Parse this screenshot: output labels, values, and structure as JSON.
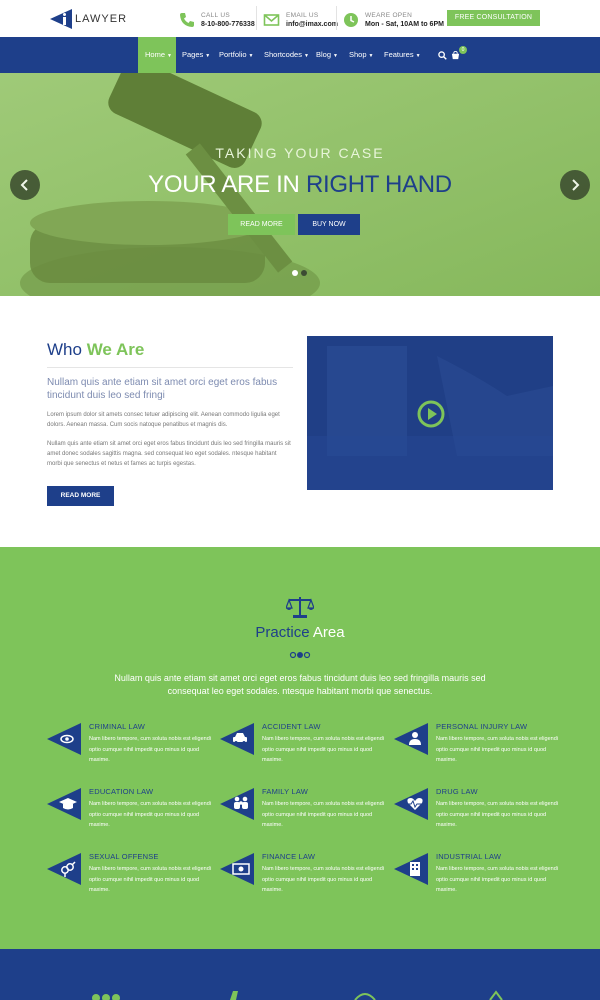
{
  "brand": {
    "logo_text": "LAWYER"
  },
  "contact": {
    "call_label": "CALL US",
    "call_value": "8-10-800-776338",
    "email_label": "EMAIL US",
    "email_value": "info@imax.com",
    "open_label": "WEARE OPEN",
    "open_value": "Mon - Sat, 10AM to 6PM",
    "cta": "FREE CONSULTATION"
  },
  "nav": {
    "items": [
      "Home",
      "Pages",
      "Portfolio",
      "Shortcodes",
      "Blog",
      "Shop",
      "Features"
    ],
    "cart_count": "0"
  },
  "hero": {
    "tagline": "TAKING YOUR CASE",
    "headline_part1": "YOUR ARE IN ",
    "headline_part2": "RIGHT HAND",
    "btn_read": "READ MORE",
    "btn_buy": "BUY NOW"
  },
  "who": {
    "title_1": "Who ",
    "title_2": "We Are",
    "lead": "Nullam quis ante etiam sit amet orci eget eros fabus tincidunt duis leo sed fringi",
    "p1": "Lorem ipsum dolor sit amets consec tetuer adipiscing elit. Aenean commodo ligulia eget dolors. Aenean massa. Cum socis natoque penatibus et magnis dis.",
    "p2": "Nullam quis ante etiam sit amet orci eget eros fabus tincidunt duis leo sed fringilla mauris sit amet donec sodales sagittis magna. sed consequat leo eget sodales. ntesque habitant morbi que senectus et netus et fames ac turpis egestas.",
    "button": "READ MORE"
  },
  "practice": {
    "title_1": "Practice ",
    "title_2": "Area",
    "lead": "Nullam quis ante etiam sit amet orci eget eros fabus tincidunt duis leo sed fringilla mauris sed consequat leo eget sodales. ntesque habitant morbi que senectus.",
    "services": [
      {
        "title": "CRIMINAL LAW",
        "icon": "eye-icon",
        "desc": "Nam libero tempore, cum soluta nobis est eligendi optio cumque nihil impedit quo minus id quod maxime."
      },
      {
        "title": "ACCIDENT LAW",
        "icon": "car-icon",
        "desc": "Nam libero tempore, cum soluta nobis est eligendi optio cumque nihil impedit quo minus id quod maxime."
      },
      {
        "title": "PERSONAL INJURY LAW",
        "icon": "person-icon",
        "desc": "Nam libero tempore, cum soluta nobis est eligendi optio cumque nihil impedit quo minus id quod maxime."
      },
      {
        "title": "EDUCATION LAW",
        "icon": "graduation-cap-icon",
        "desc": "Nam libero tempore, cum soluta nobis est eligendi optio cumque nihil impedit quo minus id quod maxime."
      },
      {
        "title": "FAMILY LAW",
        "icon": "family-icon",
        "desc": "Nam libero tempore, cum soluta nobis est eligendi optio cumque nihil impedit quo minus id quod maxime."
      },
      {
        "title": "DRUG LAW",
        "icon": "heartbeat-icon",
        "desc": "Nam libero tempore, cum soluta nobis est eligendi optio cumque nihil impedit quo minus id quod maxime."
      },
      {
        "title": "SEXUAL OFFENSE",
        "icon": "gender-icon",
        "desc": "Nam libero tempore, cum soluta nobis est eligendi optio cumque nihil impedit quo minus id quod maxime."
      },
      {
        "title": "FINANCE LAW",
        "icon": "money-icon",
        "desc": "Nam libero tempore, cum soluta nobis est eligendi optio cumque nihil impedit quo minus id quod maxime."
      },
      {
        "title": "INDUSTRIAL LAW",
        "icon": "building-icon",
        "desc": "Nam libero tempore, cum soluta nobis est eligendi optio cumque nihil impedit quo minus id quod maxime."
      }
    ]
  },
  "colors": {
    "primary": "#1e3f8a",
    "accent": "#7ec45a"
  }
}
